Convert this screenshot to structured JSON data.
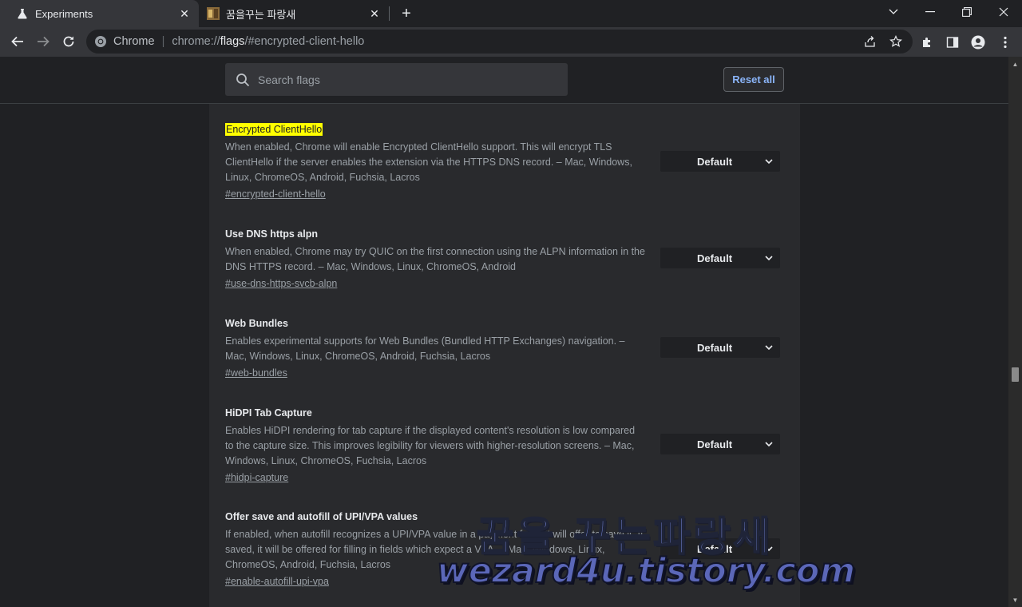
{
  "browser": {
    "tabs": [
      {
        "title": "Experiments",
        "active": true,
        "icon": "flask-icon"
      },
      {
        "title": "꿈을꾸는 파랑새",
        "active": false,
        "icon": "site-favicon"
      }
    ],
    "omnibox": {
      "prefix": "Chrome",
      "url_scheme": "chrome://",
      "url_host": "flags",
      "url_rest": "/#encrypted-client-hello"
    }
  },
  "flags": {
    "search_placeholder": "Search flags",
    "reset_label": "Reset all",
    "experiments": [
      {
        "title": "Encrypted ClientHello",
        "highlighted": true,
        "description": "When enabled, Chrome will enable Encrypted ClientHello support. This will encrypt TLS ClientHello if the server enables the extension via the HTTPS DNS record. – Mac, Windows, Linux, ChromeOS, Android, Fuchsia, Lacros",
        "link": "#encrypted-client-hello",
        "value": "Default"
      },
      {
        "title": "Use DNS https alpn",
        "highlighted": false,
        "description": "When enabled, Chrome may try QUIC on the first connection using the ALPN information in the DNS HTTPS record. – Mac, Windows, Linux, ChromeOS, Android",
        "link": "#use-dns-https-svcb-alpn",
        "value": "Default"
      },
      {
        "title": "Web Bundles",
        "highlighted": false,
        "description": "Enables experimental supports for Web Bundles (Bundled HTTP Exchanges) navigation. – Mac, Windows, Linux, ChromeOS, Android, Fuchsia, Lacros",
        "link": "#web-bundles",
        "value": "Default"
      },
      {
        "title": "HiDPI Tab Capture",
        "highlighted": false,
        "description": "Enables HiDPI rendering for tab capture if the displayed content's resolution is low compared to the capture size. This improves legibility for viewers with higher-resolution screens. – Mac, Windows, Linux, ChromeOS, Fuchsia, Lacros",
        "link": "#hidpi-capture",
        "value": "Default"
      },
      {
        "title": "Offer save and autofill of UPI/VPA values",
        "highlighted": false,
        "description": "If enabled, when autofill recognizes a UPI/VPA value in a payment form, it will offer to save it. If saved, it will be offered for filling in fields which expect a VPA. – Mac, Windows, Linux, ChromeOS, Android, Fuchsia, Lacros",
        "link": "#enable-autofill-upi-vpa",
        "value": "Default"
      }
    ]
  },
  "watermark": {
    "line1": "꿈을 꾸는파랑새",
    "line2": "wezard4u.tistory.com"
  }
}
